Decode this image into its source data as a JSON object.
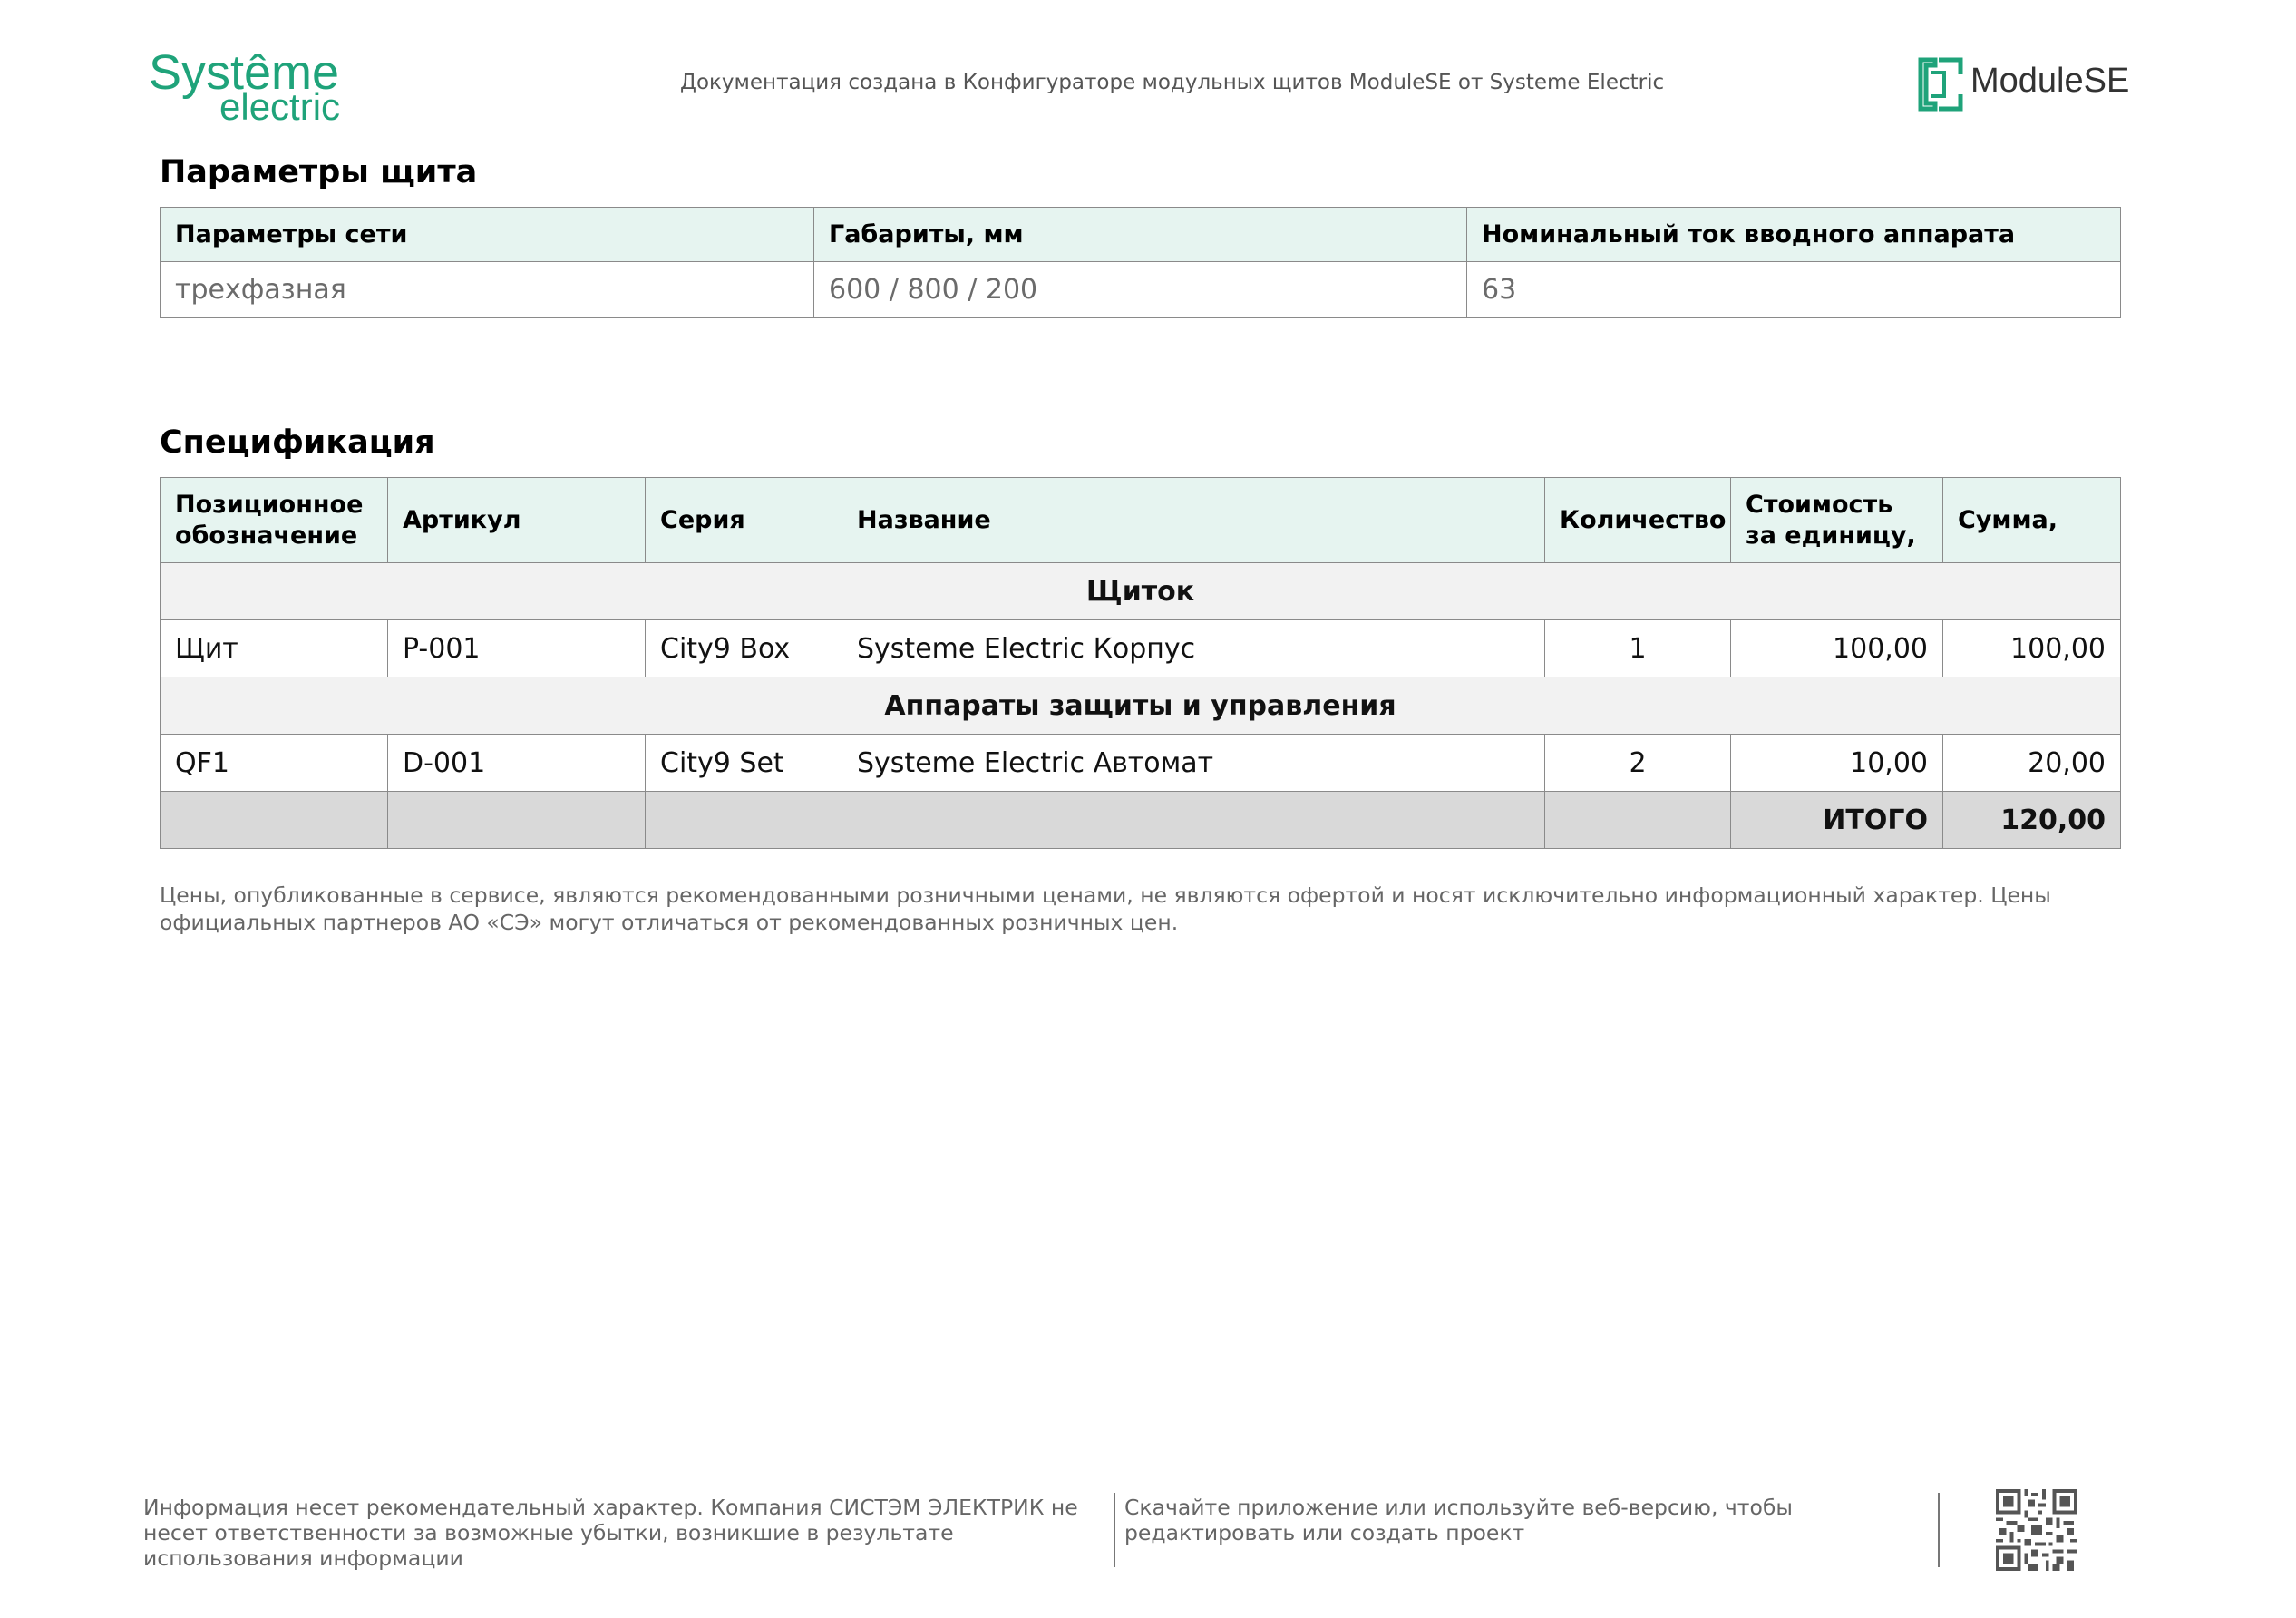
{
  "header": {
    "logo_line1": "Systême",
    "logo_line2": "electric",
    "note": "Документация создана в Конфигураторе модульных щитов ModuleSE от Systeme Electric",
    "product_logo": "ModuleSE"
  },
  "params_section": {
    "title": "Параметры щита",
    "headers": [
      "Параметры сети",
      "Габариты, мм",
      "Номинальный ток вводного аппарата"
    ],
    "values": [
      "трехфазная",
      "600 / 800 / 200",
      "63"
    ]
  },
  "spec_section": {
    "title": "Спецификация",
    "headers": [
      "Позиционное обозначение",
      "Артикул",
      "Серия",
      "Название",
      "Количество",
      "Стоимость за единицу,",
      "Сумма,"
    ],
    "groups": [
      {
        "name": "Щиток",
        "rows": [
          {
            "position": "Щит",
            "article": "P-001",
            "series": "City9 Box",
            "name": "Systeme Electric Корпус",
            "qty": "1",
            "unit_price": "100,00",
            "sum": "100,00"
          }
        ]
      },
      {
        "name": "Аппараты защиты и управления",
        "rows": [
          {
            "position": "QF1",
            "article": "D-001",
            "series": "City9 Set",
            "name": "Systeme Electric Автомат",
            "qty": "2",
            "unit_price": "10,00",
            "sum": "20,00"
          }
        ]
      }
    ],
    "total_label": "ИТОГО",
    "total_value": "120,00"
  },
  "disclaimer": "Цены, опубликованные в сервисе, являются рекомендованными розничными ценами, не являются офертой и носят исключительно информационный характер. Цены официальных партнеров АО «СЭ» могут отличаться от рекомендованных розничных цен.",
  "footer": {
    "left": "Информация несет рекомендательный характер. Компания СИСТЭМ ЭЛЕКТРИК не несет ответственности за возможные убытки, возникшие в результате использования информации",
    "middle": "Скачайте приложение или используйте веб-версию, чтобы редактировать или создать проект",
    "qr_icon": "qr-code-icon"
  },
  "colors": {
    "brand": "#1fa37a",
    "header_fill": "#e6f4f0",
    "group_fill": "#f2f2f2",
    "total_fill": "#d9d9d9"
  }
}
